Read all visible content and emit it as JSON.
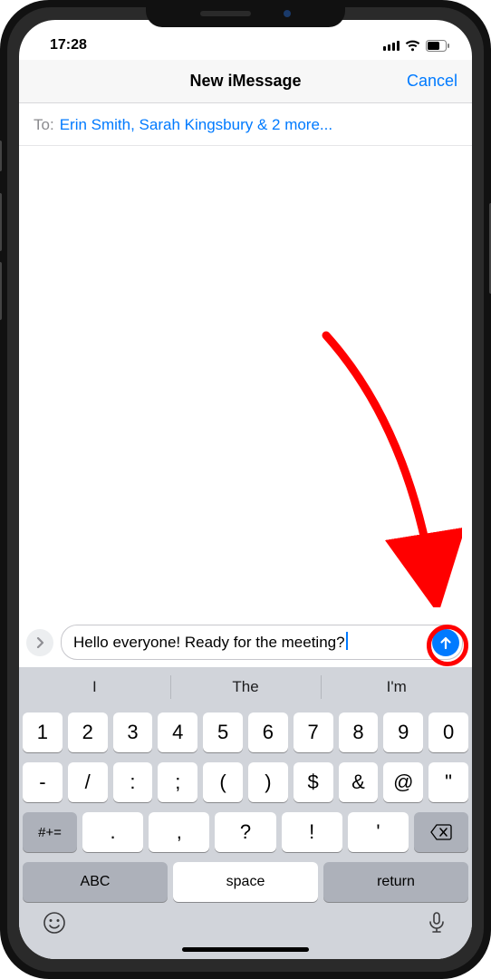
{
  "status": {
    "time": "17:28"
  },
  "nav": {
    "title": "New iMessage",
    "cancel": "Cancel"
  },
  "to": {
    "label": "To:",
    "recipients": "Erin Smith, Sarah Kingsbury & 2 more..."
  },
  "compose": {
    "text": "Hello everyone! Ready for the meeting?"
  },
  "suggestions": [
    "I",
    "The",
    "I'm"
  ],
  "keyboard": {
    "row1": [
      "1",
      "2",
      "3",
      "4",
      "5",
      "6",
      "7",
      "8",
      "9",
      "0"
    ],
    "row2": [
      "-",
      "/",
      ":",
      ";",
      "(",
      ")",
      "$",
      "&",
      "@",
      "\""
    ],
    "shift_label": "#+=",
    "row3": [
      ".",
      ",",
      "?",
      "!",
      "'"
    ],
    "abc": "ABC",
    "space": "space",
    "return": "return"
  }
}
